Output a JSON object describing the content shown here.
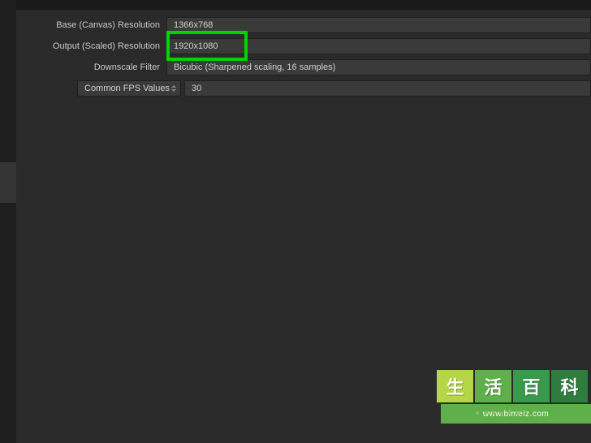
{
  "settings": {
    "base_resolution": {
      "label": "Base (Canvas) Resolution",
      "value": "1366x768"
    },
    "output_resolution": {
      "label": "Output (Scaled) Resolution",
      "value": "1920x1080"
    },
    "downscale_filter": {
      "label": "Downscale Filter",
      "value": "Bicubic (Sharpened scaling, 16 samples)"
    },
    "fps": {
      "type_label": "Common FPS Values",
      "value": "30"
    }
  },
  "watermark": {
    "char1": "生",
    "char2": "活",
    "char3": "百",
    "char4": "科",
    "url": "www.bimeiz.com"
  }
}
